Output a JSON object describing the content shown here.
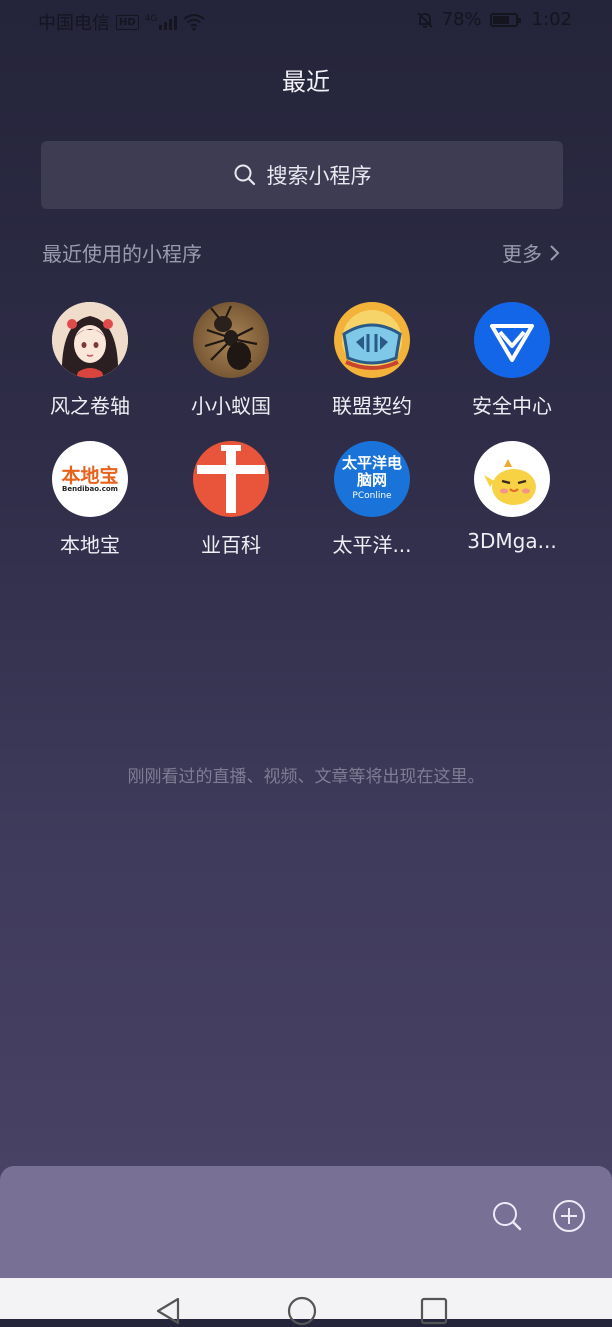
{
  "status_bar": {
    "carrier": "中国电信",
    "network_badge": "HD",
    "signal_type": "4G",
    "battery_percent": "78%",
    "time": "1:02"
  },
  "header": {
    "title": "最近"
  },
  "search": {
    "placeholder": "搜索小程序"
  },
  "recent_section": {
    "title": "最近使用的小程序",
    "more_label": "更多"
  },
  "apps": [
    {
      "label": "风之卷轴",
      "icon": "anime-girl-icon"
    },
    {
      "label": "小小蚁国",
      "icon": "ant-icon"
    },
    {
      "label": "联盟契约",
      "icon": "game-character-icon"
    },
    {
      "label": "安全中心",
      "icon": "shield-check-icon"
    },
    {
      "label": "本地宝",
      "icon": "bendibao-logo-icon",
      "logo_text": "本地宝",
      "logo_subtext": "Bendibao.com"
    },
    {
      "label": "业百科",
      "icon": "cross-logo-icon"
    },
    {
      "label": "太平洋...",
      "icon": "pconline-logo-icon",
      "logo_text": "太平洋电脑网",
      "logo_subtext": "PConline"
    },
    {
      "label": "3DMga...",
      "icon": "yellow-bird-icon"
    }
  ],
  "empty_hint": "刚刚看过的直播、视频、文章等将出现在这里。",
  "colors": {
    "accent_blue": "#1466e8",
    "orange_red": "#e8553a",
    "panel": "#787095"
  }
}
